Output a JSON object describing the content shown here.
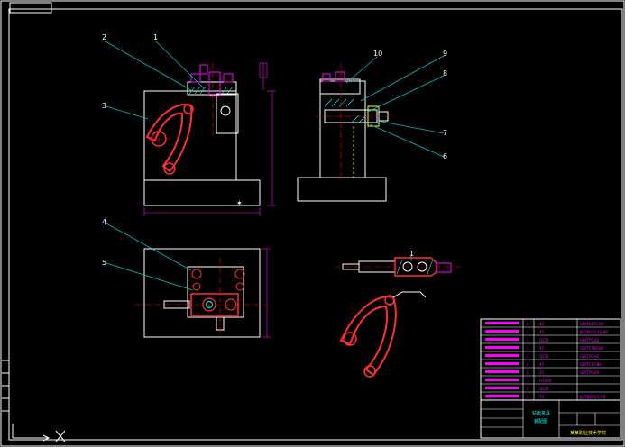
{
  "drawing": {
    "background": "#000000",
    "border_color": "#ffffff",
    "leader_color": "#00c0c0",
    "part_color": "#ff3030",
    "center_color": "#ff0000",
    "dim_color": "#ff00ff",
    "hatch_color": "#00ffff"
  },
  "balloons": [
    {
      "id": "balloon-1",
      "label": "1"
    },
    {
      "id": "balloon-2",
      "label": "2"
    },
    {
      "id": "balloon-3",
      "label": "3"
    },
    {
      "id": "balloon-4",
      "label": "4"
    },
    {
      "id": "balloon-5",
      "label": "5"
    },
    {
      "id": "balloon-6",
      "label": "6"
    },
    {
      "id": "balloon-7",
      "label": "7"
    },
    {
      "id": "balloon-8",
      "label": "8"
    },
    {
      "id": "balloon-9",
      "label": "9"
    },
    {
      "id": "balloon-10",
      "label": "10"
    }
  ],
  "parts_list": {
    "rows": [
      {
        "qty": "1",
        "material": "45",
        "code": "GB/T6170-86"
      },
      {
        "qty": "1",
        "material": "45",
        "code": "JB/T8010.13-99"
      },
      {
        "qty": "1",
        "material": "Q235",
        "code": "GB/T75-85"
      },
      {
        "qty": "1",
        "material": "45",
        "code": "GB/T5783-86"
      },
      {
        "qty": "1",
        "material": "Q235",
        "code": "GB/T70-85"
      },
      {
        "qty": "4",
        "material": "45",
        "code": "GB/T117-86"
      },
      {
        "qty": "2",
        "material": "35",
        "code": "GB/T70-85"
      },
      {
        "qty": "1",
        "material": "HT200",
        "code": ""
      },
      {
        "qty": "1",
        "material": "Q235",
        "code": ""
      },
      {
        "qty": "1",
        "material": "T8",
        "code": "JB/T8045.3-99"
      }
    ]
  },
  "title_block": {
    "title_line1": "钻床夹具",
    "title_line2": "装配图",
    "school": "某某职业技术学院"
  }
}
